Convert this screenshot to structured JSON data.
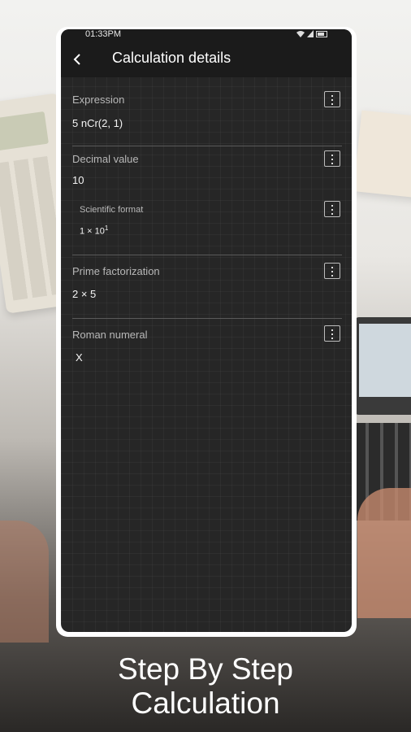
{
  "status_bar": {
    "time": "01:33PM"
  },
  "app_bar": {
    "title": "Calculation details",
    "back_icon": "back-arrow-icon"
  },
  "sections": {
    "expression": {
      "label": "Expression",
      "value": "5 nCr(2, 1)"
    },
    "decimal": {
      "label": "Decimal value",
      "value": "10",
      "scientific": {
        "label": "Scientific format",
        "mantissa": "1 × 10",
        "exponent": "1"
      }
    },
    "prime": {
      "label": "Prime factorization",
      "value": "2 × 5"
    },
    "roman": {
      "label": "Roman numeral",
      "value": "X"
    }
  },
  "menu_icon": "more-vert-icon",
  "caption": {
    "line1": "Step By Step",
    "line2": "Calculation"
  }
}
